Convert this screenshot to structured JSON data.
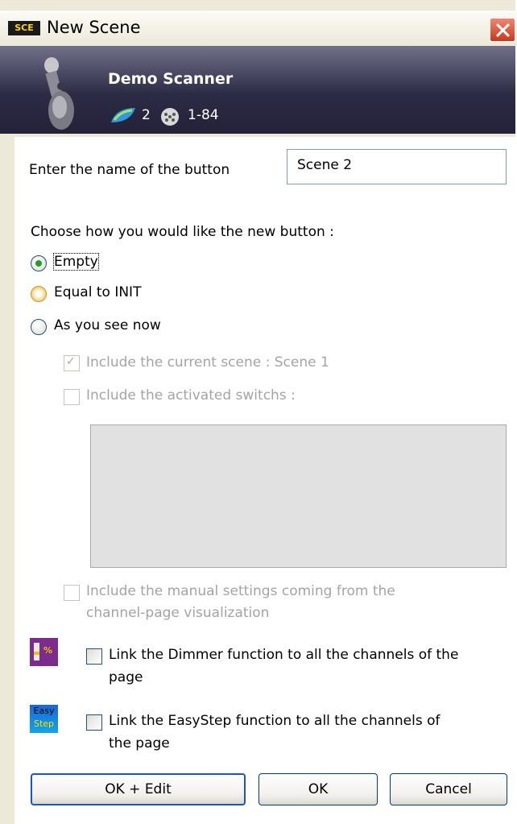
{
  "window": {
    "title": "New Scene",
    "icon_text": "SCE"
  },
  "fixture": {
    "name": "Demo Scanner",
    "universe": "2",
    "dmx_range": "1-84"
  },
  "button_name": {
    "label": "Enter the name of the button",
    "value": "Scene 2"
  },
  "options": {
    "prompt": "Choose how you would like the new button :",
    "radios": [
      {
        "label": "Empty",
        "selected": true
      },
      {
        "label": "Equal to INIT",
        "selected": false
      },
      {
        "label": "As you see now",
        "selected": false
      }
    ],
    "include_current_scene": "Include the current scene : Scene 1",
    "include_switches": "Include the activated switchs :",
    "include_manual_line1": "Include the manual settings coming from the",
    "include_manual_line2": "channel-page visualization"
  },
  "links": {
    "dimmer_line1": "Link the Dimmer function to all the channels of the",
    "dimmer_line2": "page",
    "dimmer_icon_text": "%",
    "easystep_line1": "Link the EasyStep function to all the channels of",
    "easystep_line2": "the page",
    "easystep_icon_line1": "Easy",
    "easystep_icon_line2": "Step"
  },
  "buttons": {
    "ok_edit": "OK + Edit",
    "ok": "OK",
    "cancel": "Cancel"
  }
}
